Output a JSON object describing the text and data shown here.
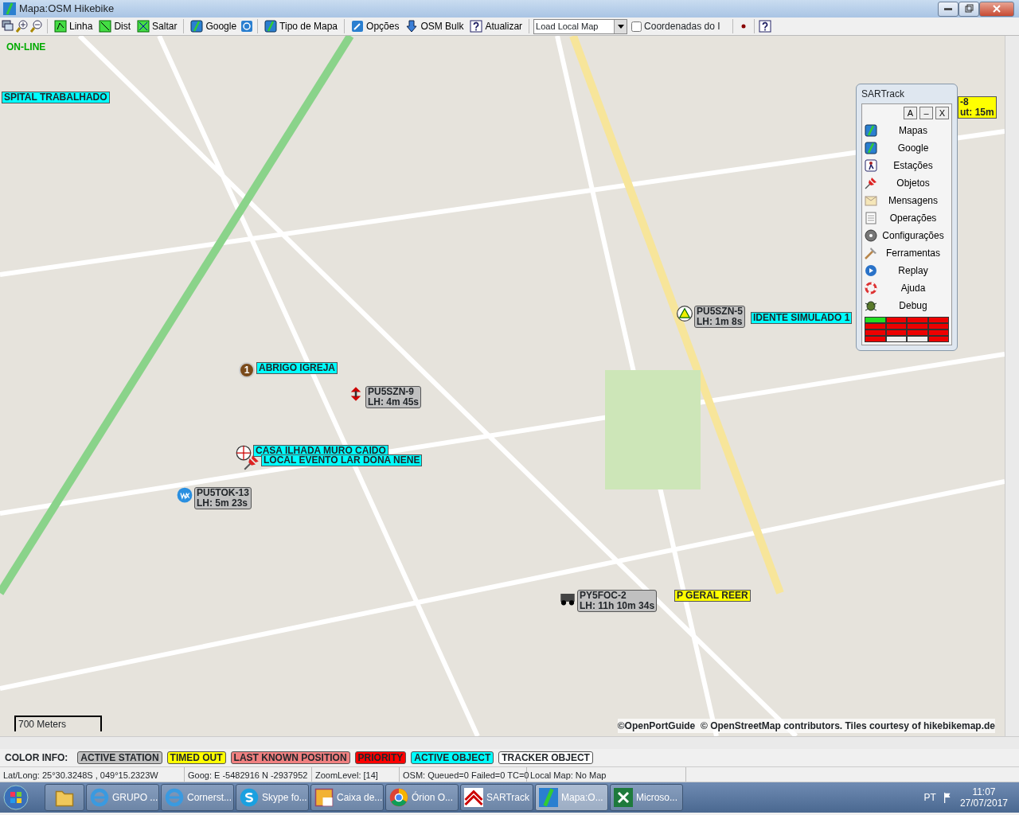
{
  "window": {
    "title": "Mapa:OSM Hikebike"
  },
  "toolbar": [
    {
      "kind": "icon"
    },
    {
      "kind": "icon"
    },
    {
      "kind": "icon"
    },
    {
      "kind": "button",
      "label": "Linha"
    },
    {
      "kind": "button",
      "label": "Dist"
    },
    {
      "kind": "button",
      "label": "Saltar"
    },
    {
      "kind": "button",
      "label": "Google"
    },
    {
      "kind": "icon"
    },
    {
      "kind": "button",
      "label": "Tipo de Mapa"
    },
    {
      "kind": "button",
      "label": "Opções"
    },
    {
      "kind": "button",
      "label": "OSM Bulk"
    },
    {
      "kind": "button",
      "label": "Atualizar"
    },
    {
      "kind": "dropdown",
      "value": "Load Local Map"
    },
    {
      "kind": "checkbox",
      "label": "Coordenadas do I",
      "checked": false
    },
    {
      "kind": "icon"
    },
    {
      "kind": "icon"
    }
  ],
  "map": {
    "status": "ON-LINE",
    "scale": "700 Meters",
    "attribution": "©OpenPortGuide  © OpenStreetMap contributors. Tiles courtesy of hikebikemap.de",
    "markers": [
      {
        "kind": "object",
        "lines": [
          "SPITAL TRABALHADO"
        ]
      },
      {
        "kind": "timed",
        "lines": [
          "-8",
          "ut: 15m"
        ]
      },
      {
        "kind": "station",
        "lines": [
          "PU5SZN-5",
          "LH: 1m 8s"
        ]
      },
      {
        "kind": "object",
        "lines": [
          "IDENTE SIMULADO 1"
        ]
      },
      {
        "kind": "object",
        "number": "1",
        "lines": [
          "ABRIGO IGREJA"
        ]
      },
      {
        "kind": "station",
        "lines": [
          "PU5SZN-9",
          "LH: 4m 45s"
        ]
      },
      {
        "kind": "object",
        "lines": [
          "CASA ILHADA MURO CAIDO"
        ]
      },
      {
        "kind": "object",
        "lines": [
          "LOCAL EVENTO LAR DONA NENE"
        ]
      },
      {
        "kind": "station",
        "lines": [
          "PU5TOK-13",
          "LH: 5m 23s"
        ]
      },
      {
        "kind": "station",
        "lines": [
          "PY5FOC-2",
          "LH: 11h 10m 34s"
        ]
      },
      {
        "kind": "timed",
        "lines": [
          "P GERAL REER"
        ]
      }
    ]
  },
  "panel": {
    "title": "SARTrack",
    "buttons": [
      "A",
      "–",
      "X"
    ],
    "items": [
      {
        "label": "Mapas"
      },
      {
        "label": "Google"
      },
      {
        "label": "Estações"
      },
      {
        "label": "Objetos"
      },
      {
        "label": "Mensagens"
      },
      {
        "label": "Operações"
      },
      {
        "label": "Configurações"
      },
      {
        "label": "Ferramentas"
      },
      {
        "label": "Replay"
      },
      {
        "label": "Ajuda"
      },
      {
        "label": "Debug"
      }
    ],
    "grid": [
      [
        {
          "color": "#22dd22"
        },
        {
          "color": "#ee0000"
        },
        {
          "color": "#ee0000"
        },
        {
          "color": "#ee0000"
        }
      ],
      [
        {
          "color": "#ee0000"
        },
        {
          "color": "#ee0000"
        },
        {
          "color": "#ee0000"
        },
        {
          "color": "#ee0000"
        }
      ],
      [
        {
          "color": "#ee0000"
        },
        {
          "color": "#ee0000"
        },
        {
          "color": "#ee0000"
        },
        {
          "color": "#ee0000"
        }
      ],
      [
        {
          "color": "#ee0000"
        },
        {
          "color": "#eeeeee"
        },
        {
          "color": "#eeeeee"
        },
        {
          "color": "#ee0000"
        }
      ]
    ]
  },
  "legend": {
    "title": "COLOR INFO:",
    "items": [
      {
        "label": "ACTIVE STATION",
        "color": "#c0c0c0"
      },
      {
        "label": "TIMED OUT",
        "color": "#ffff00"
      },
      {
        "label": "LAST KNOWN POSITION",
        "color": "#f08080"
      },
      {
        "label": "PRIORITY",
        "color": "#ff0000"
      },
      {
        "label": "ACTIVE OBJECT",
        "color": "#00ffff"
      },
      {
        "label": "TRACKER OBJECT",
        "color": "#ffffff"
      }
    ]
  },
  "status_bar": [
    "Lat/Long: 25°30.3248S , 049°15.2323W",
    "Goog: E -5482916  N -2937952",
    "ZoomLevel: [14]",
    "OSM: Queued=0 Failed=0 TC=0",
    "Local Map: No Map"
  ],
  "taskbar": {
    "tasks": [
      {
        "selected": false
      },
      {
        "label": "GRUPO ...",
        "selected": false
      },
      {
        "label": "Cornerst...",
        "selected": false
      },
      {
        "label": "Skype fo...",
        "selected": false
      },
      {
        "label": "Caixa de...",
        "selected": false
      },
      {
        "label": "Órion O...",
        "selected": false
      },
      {
        "label": "SARTrack",
        "selected": false
      },
      {
        "label": "Mapa:O...",
        "selected": true
      },
      {
        "label": "Microso...",
        "selected": false
      }
    ],
    "language": "PT",
    "time": "11:07",
    "date": "27/07/2017"
  }
}
